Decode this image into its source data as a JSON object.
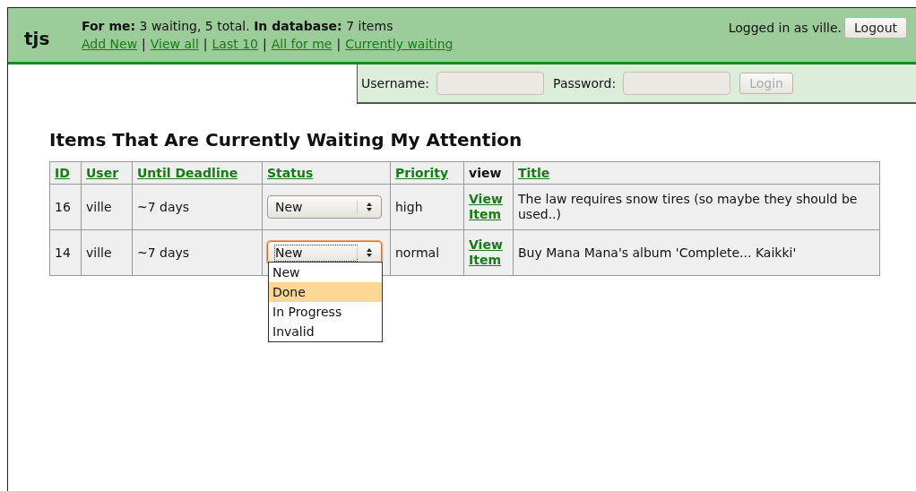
{
  "header": {
    "logo": "tjs",
    "summary": "**For me:** 3 waiting, 5 total. **In database:** 7 items",
    "nav": [
      {
        "label": "Add New"
      },
      {
        "label": "View all"
      },
      {
        "label": "Last 10"
      },
      {
        "label": "All for me"
      },
      {
        "label": "Currently waiting"
      }
    ],
    "separator": "|",
    "logged_in": "Logged in as ville.",
    "logout": "Logout"
  },
  "login": {
    "username_label": "Username:",
    "password_label": "Password:",
    "button": "Login",
    "disabled": true
  },
  "heading": "Items That Are Currently Waiting My Attention",
  "table": {
    "columns": [
      {
        "label": "ID",
        "link": true
      },
      {
        "label": "User",
        "link": true
      },
      {
        "label": "Until Deadline",
        "link": true
      },
      {
        "label": "Status",
        "link": true
      },
      {
        "label": "Priority",
        "link": true
      },
      {
        "label": "view",
        "link": false
      },
      {
        "label": "Title",
        "link": true
      }
    ],
    "rows": [
      {
        "id": "16",
        "user": "ville",
        "deadline": "~7 days",
        "status": "New",
        "focused": false,
        "priority": "high",
        "view": "View Item",
        "title": "The law requires snow tires (so maybe they should be used..)"
      },
      {
        "id": "14",
        "user": "ville",
        "deadline": "~7 days",
        "status": "New",
        "focused": true,
        "options": [
          {
            "label": "New",
            "selected": false
          },
          {
            "label": "Done",
            "selected": true
          },
          {
            "label": "In Progress",
            "selected": false
          },
          {
            "label": "Invalid",
            "selected": false
          }
        ],
        "priority": "normal",
        "view": "View Item",
        "title": "Buy Mana Mana's album 'Complete... Kaikki'"
      }
    ]
  }
}
